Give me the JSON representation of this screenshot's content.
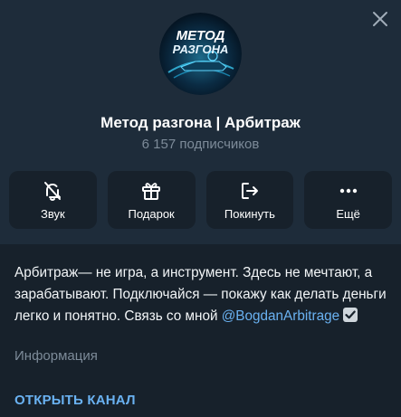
{
  "channel": {
    "avatar_text_line1": "МЕТОД",
    "avatar_text_line2": "РАЗГОНА",
    "title": "Метод разгона | Арбитраж",
    "subscribers": "6 157 подписчиков"
  },
  "actions": [
    {
      "label": "Звук",
      "icon": "bell-off-icon"
    },
    {
      "label": "Подарок",
      "icon": "gift-icon"
    },
    {
      "label": "Покинуть",
      "icon": "leave-icon"
    },
    {
      "label": "Ещё",
      "icon": "more-icon"
    }
  ],
  "info": {
    "description": "Арбитраж— не игра, а инструмент. Здесь не мечтают, а зарабатывают. Подключайся — покажу как делать деньги легко и понятно. Связь со мной ",
    "contact_link": "@BogdanArbitrage",
    "label": "Информация"
  },
  "open_channel_label": "ОТКРЫТЬ КАНАЛ",
  "colors": {
    "background": "#1e2c3a",
    "panel": "#17212b",
    "accent": "#6ab2f2",
    "muted": "#7d8b99"
  }
}
